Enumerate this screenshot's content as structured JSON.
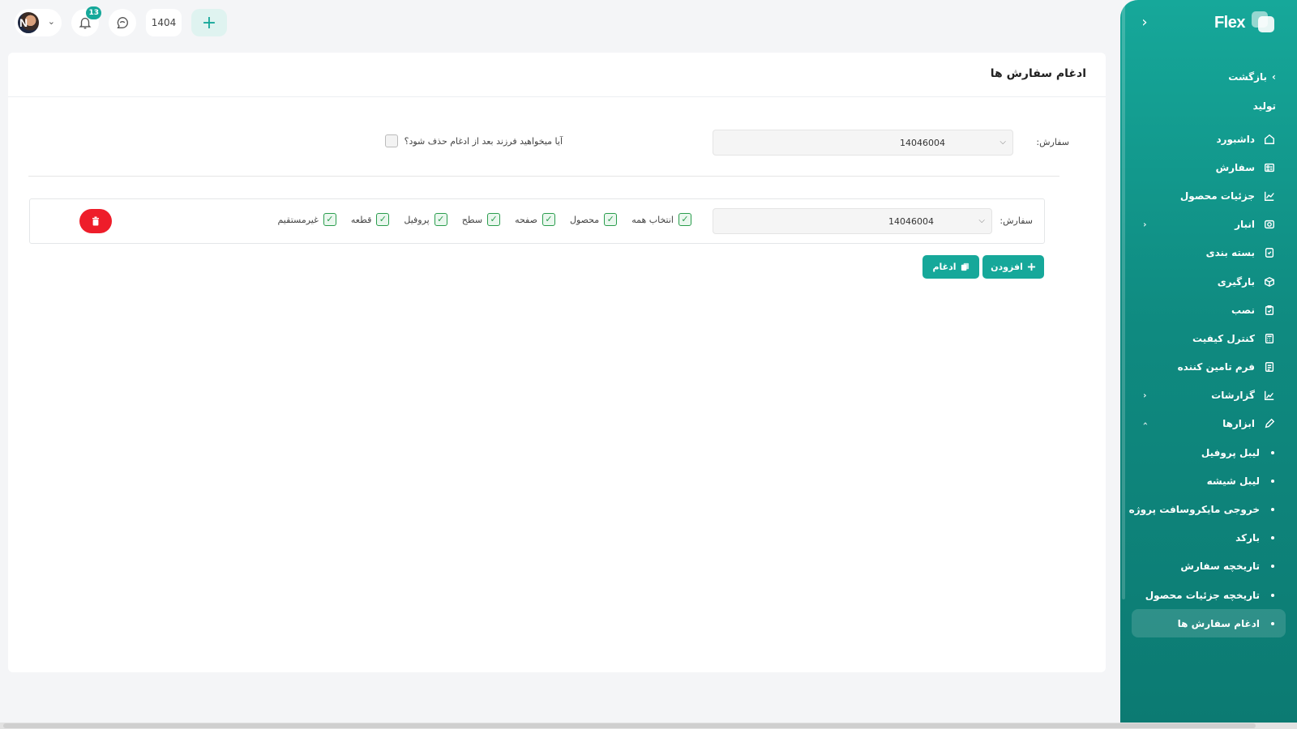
{
  "brand": {
    "name": "Flex"
  },
  "topbar": {
    "avatar_initial": "N",
    "notification_count": "13",
    "year": "1404"
  },
  "sidebar": {
    "back_label": "بازگشت",
    "section_label": "تولید",
    "items": [
      {
        "label": "داشبورد",
        "icon": "home-icon"
      },
      {
        "label": "سفارش",
        "icon": "id-card-icon"
      },
      {
        "label": "جزئیات محصول",
        "icon": "chart-icon"
      },
      {
        "label": "انبار",
        "icon": "warehouse-icon",
        "has_submenu": true
      },
      {
        "label": "بسته بندی",
        "icon": "package-icon"
      },
      {
        "label": "بارگیری",
        "icon": "box-icon"
      },
      {
        "label": "نصب",
        "icon": "clipboard-check-icon"
      },
      {
        "label": "کنترل کیفیت",
        "icon": "calculator-icon"
      },
      {
        "label": "فرم تامین کننده",
        "icon": "form-icon"
      },
      {
        "label": "گزارشات",
        "icon": "trend-icon",
        "has_submenu": true
      },
      {
        "label": "ابزارها",
        "icon": "pencil-icon",
        "expanded": true
      }
    ],
    "subitems": [
      {
        "label": "لیبل پروفیل"
      },
      {
        "label": "لیبل شیشه"
      },
      {
        "label": "خروجی مایکروسافت پروژه"
      },
      {
        "label": "بارکد"
      },
      {
        "label": "تاریخچه سفارش"
      },
      {
        "label": "تاریخچه جزئیات محصول"
      },
      {
        "label": "ادغام سفارش ها",
        "active": true
      }
    ]
  },
  "page": {
    "title": "ادغام سفارش ها",
    "main_order_label": "سفارش:",
    "main_order_value": "14046004",
    "delete_child_question": "آیا میخواهید فرزند بعد از ادغام حذف شود؟",
    "row": {
      "order_label": "سفارش:",
      "order_value": "14046004",
      "checkboxes": [
        "انتخاب همه",
        "محصول",
        "صفحه",
        "سطح",
        "پروفیل",
        "قطعه",
        "غیرمستقیم"
      ]
    },
    "add_button_label": "افزودن",
    "merge_button_label": "ادغام"
  },
  "colors": {
    "primary": "#16a89a",
    "danger": "#ee1d2a",
    "check": "#2a9d4d"
  }
}
